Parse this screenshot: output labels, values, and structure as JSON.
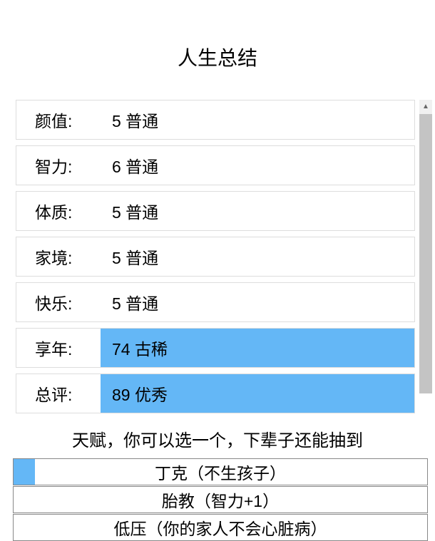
{
  "title": "人生总结",
  "stats": [
    {
      "label": "颜值:",
      "value": "5 普通",
      "highlight": false
    },
    {
      "label": "智力:",
      "value": "6 普通",
      "highlight": false
    },
    {
      "label": "体质:",
      "value": "5 普通",
      "highlight": false
    },
    {
      "label": "家境:",
      "value": "5 普通",
      "highlight": false
    },
    {
      "label": "快乐:",
      "value": "5 普通",
      "highlight": false
    },
    {
      "label": "享年:",
      "value": "74 古稀",
      "highlight": true
    },
    {
      "label": "总评:",
      "value": "89 优秀",
      "highlight": true
    }
  ],
  "talent": {
    "title": "天赋，你可以选一个，下辈子还能抽到",
    "items": [
      {
        "name": "丁克（不生孩子）",
        "selected": true
      },
      {
        "name": "胎教（智力+1）",
        "selected": false
      },
      {
        "name": "低压（你的家人不会心脏病）",
        "selected": false
      }
    ]
  }
}
